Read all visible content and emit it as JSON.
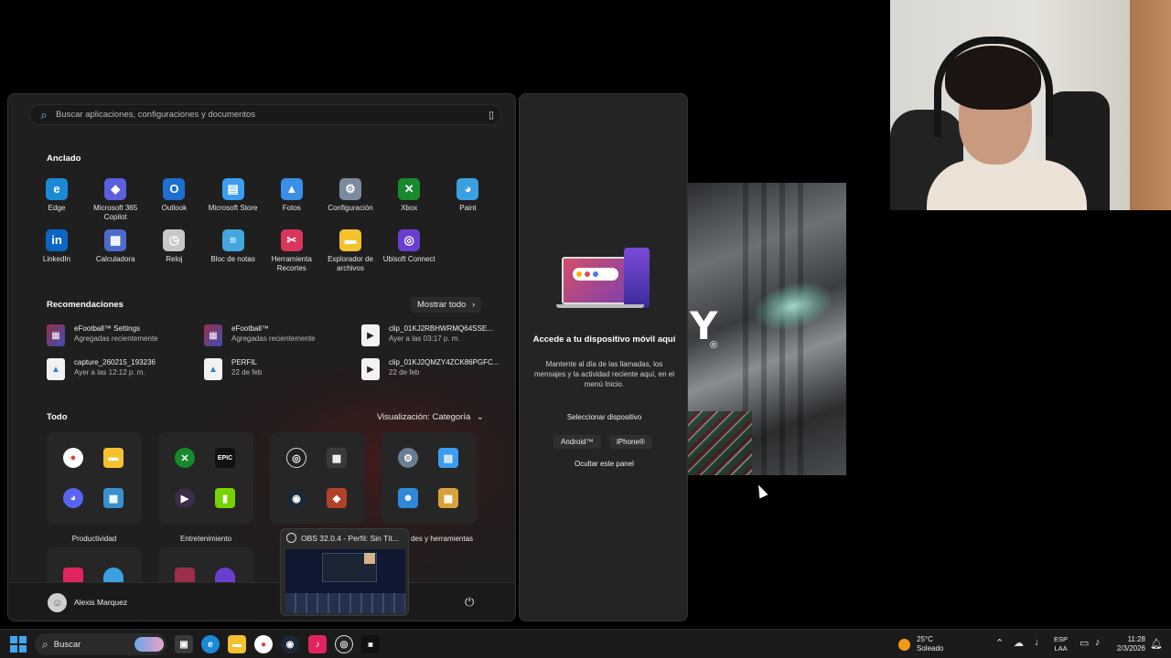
{
  "search": {
    "placeholder": "Buscar aplicaciones, configuraciones y documentos"
  },
  "pinned": {
    "title": "Anclado",
    "apps": [
      {
        "label": "Edge",
        "icon": "edge-icon",
        "color": "#1b8ad6"
      },
      {
        "label": "Microsoft 365 Copilot",
        "icon": "m365-copilot-icon",
        "color": "#5b5fe0"
      },
      {
        "label": "Outlook",
        "icon": "outlook-icon",
        "color": "#1e6fd0"
      },
      {
        "label": "Microsoft Store",
        "icon": "store-icon",
        "color": "#3b9df0"
      },
      {
        "label": "Fotos",
        "icon": "photos-icon",
        "color": "#3b8fe8"
      },
      {
        "label": "Configuración",
        "icon": "gear-icon",
        "color": "#7a8ba0"
      },
      {
        "label": "Xbox",
        "icon": "xbox-icon",
        "color": "#178a2e"
      },
      {
        "label": "Paint",
        "icon": "paint-icon",
        "color": "#3aa0e0"
      },
      {
        "label": "LinkedIn",
        "icon": "linkedin-icon",
        "color": "#0a66c2"
      },
      {
        "label": "Calculadora",
        "icon": "calculator-icon",
        "color": "#4d6bcc"
      },
      {
        "label": "Reloj",
        "icon": "clock-icon",
        "color": "#c8c8c8"
      },
      {
        "label": "Bloc de notas",
        "icon": "notepad-icon",
        "color": "#43a7de"
      },
      {
        "label": "Herramienta Recortes",
        "icon": "snipping-tool-icon",
        "color": "#d8365a"
      },
      {
        "label": "Explorador de archivos",
        "icon": "file-explorer-icon",
        "color": "#f5c12e"
      },
      {
        "label": "Ubisoft Connect",
        "icon": "ubisoft-icon",
        "color": "#6a3fd0"
      }
    ]
  },
  "recommendations": {
    "title": "Recomendaciones",
    "more_label": "Mostrar todo",
    "items": [
      {
        "title": "eFootball™ Settings",
        "subtitle": "Agregadas recientemente",
        "icon": "efootball-icon"
      },
      {
        "title": "eFootball™",
        "subtitle": "Agregadas recientemente",
        "icon": "efootball-icon"
      },
      {
        "title": "clip_01KJ2RBHWRMQ64SSE...",
        "subtitle": "Ayer a las 03:17 p. m.",
        "icon": "video-file-icon"
      },
      {
        "title": "capture_260215_193236",
        "subtitle": "Ayer a las 12:12 p. m.",
        "icon": "image-file-icon"
      },
      {
        "title": "PERFIL",
        "subtitle": "22 de feb",
        "icon": "image-file-icon"
      },
      {
        "title": "clip_01KJ2QMZY4ZCK86PGFC...",
        "subtitle": "22 de feb",
        "icon": "video-file-icon"
      }
    ]
  },
  "all": {
    "title": "Todo",
    "view_label": "Visualización: Categoría",
    "categories": [
      {
        "label": "Productividad"
      },
      {
        "label": "Entretenimiento"
      },
      {
        "label": "des y herramientas"
      }
    ]
  },
  "user": {
    "name": "Alexis Marquez"
  },
  "obs_preview": {
    "title": "OBS 32.0.4 - Perfil: Sin Tít..."
  },
  "phone_panel": {
    "title": "Accede a tu dispositivo móvil aquí",
    "description": "Mantente al día de las llamadas, los mensajes y la actividad reciente aquí, en el menú Inicio.",
    "select_label": "Seleccionar dispositivo",
    "android_label": "Android™",
    "iphone_label": "iPhone®",
    "hide_label": "Ocultar este panel"
  },
  "game_art": {
    "letter": "Y",
    "reg": "®"
  },
  "taskbar": {
    "search_label": "Buscar",
    "weather_temp": "25°C",
    "weather_desc": "Soleado",
    "lang_top": "ESP",
    "lang_bottom": "LAA",
    "time": "11:28",
    "date": "2/3/2026"
  }
}
